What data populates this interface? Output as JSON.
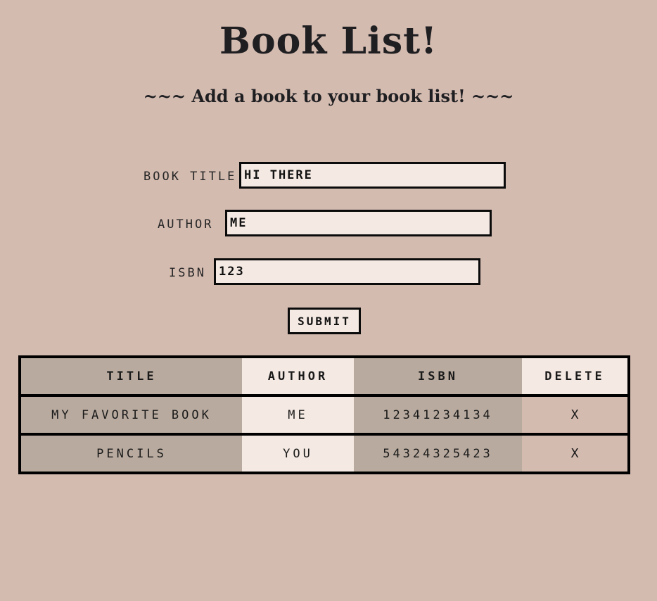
{
  "header": {
    "title": "Book List!",
    "subtitle": "~~~ Add a book to your book list! ~~~"
  },
  "form": {
    "title_label": "Book Title",
    "title_value": "HI THERE",
    "author_label": "Author",
    "author_value": "ME",
    "isbn_label": "ISBN",
    "isbn_value": "123",
    "submit_label": "Submit"
  },
  "table": {
    "headers": [
      "Title",
      "Author",
      "ISBN",
      "Delete"
    ],
    "rows": [
      {
        "title": "My Favorite Book",
        "author": "Me",
        "isbn": "12341234134",
        "delete": "X"
      },
      {
        "title": "Pencils",
        "author": "You",
        "isbn": "54324325423",
        "delete": "X"
      }
    ]
  },
  "colors": {
    "background": "#d4bbb0",
    "input_bg": "#f5eae3",
    "table_dark": "#b8aa9e",
    "border": "#000000"
  }
}
